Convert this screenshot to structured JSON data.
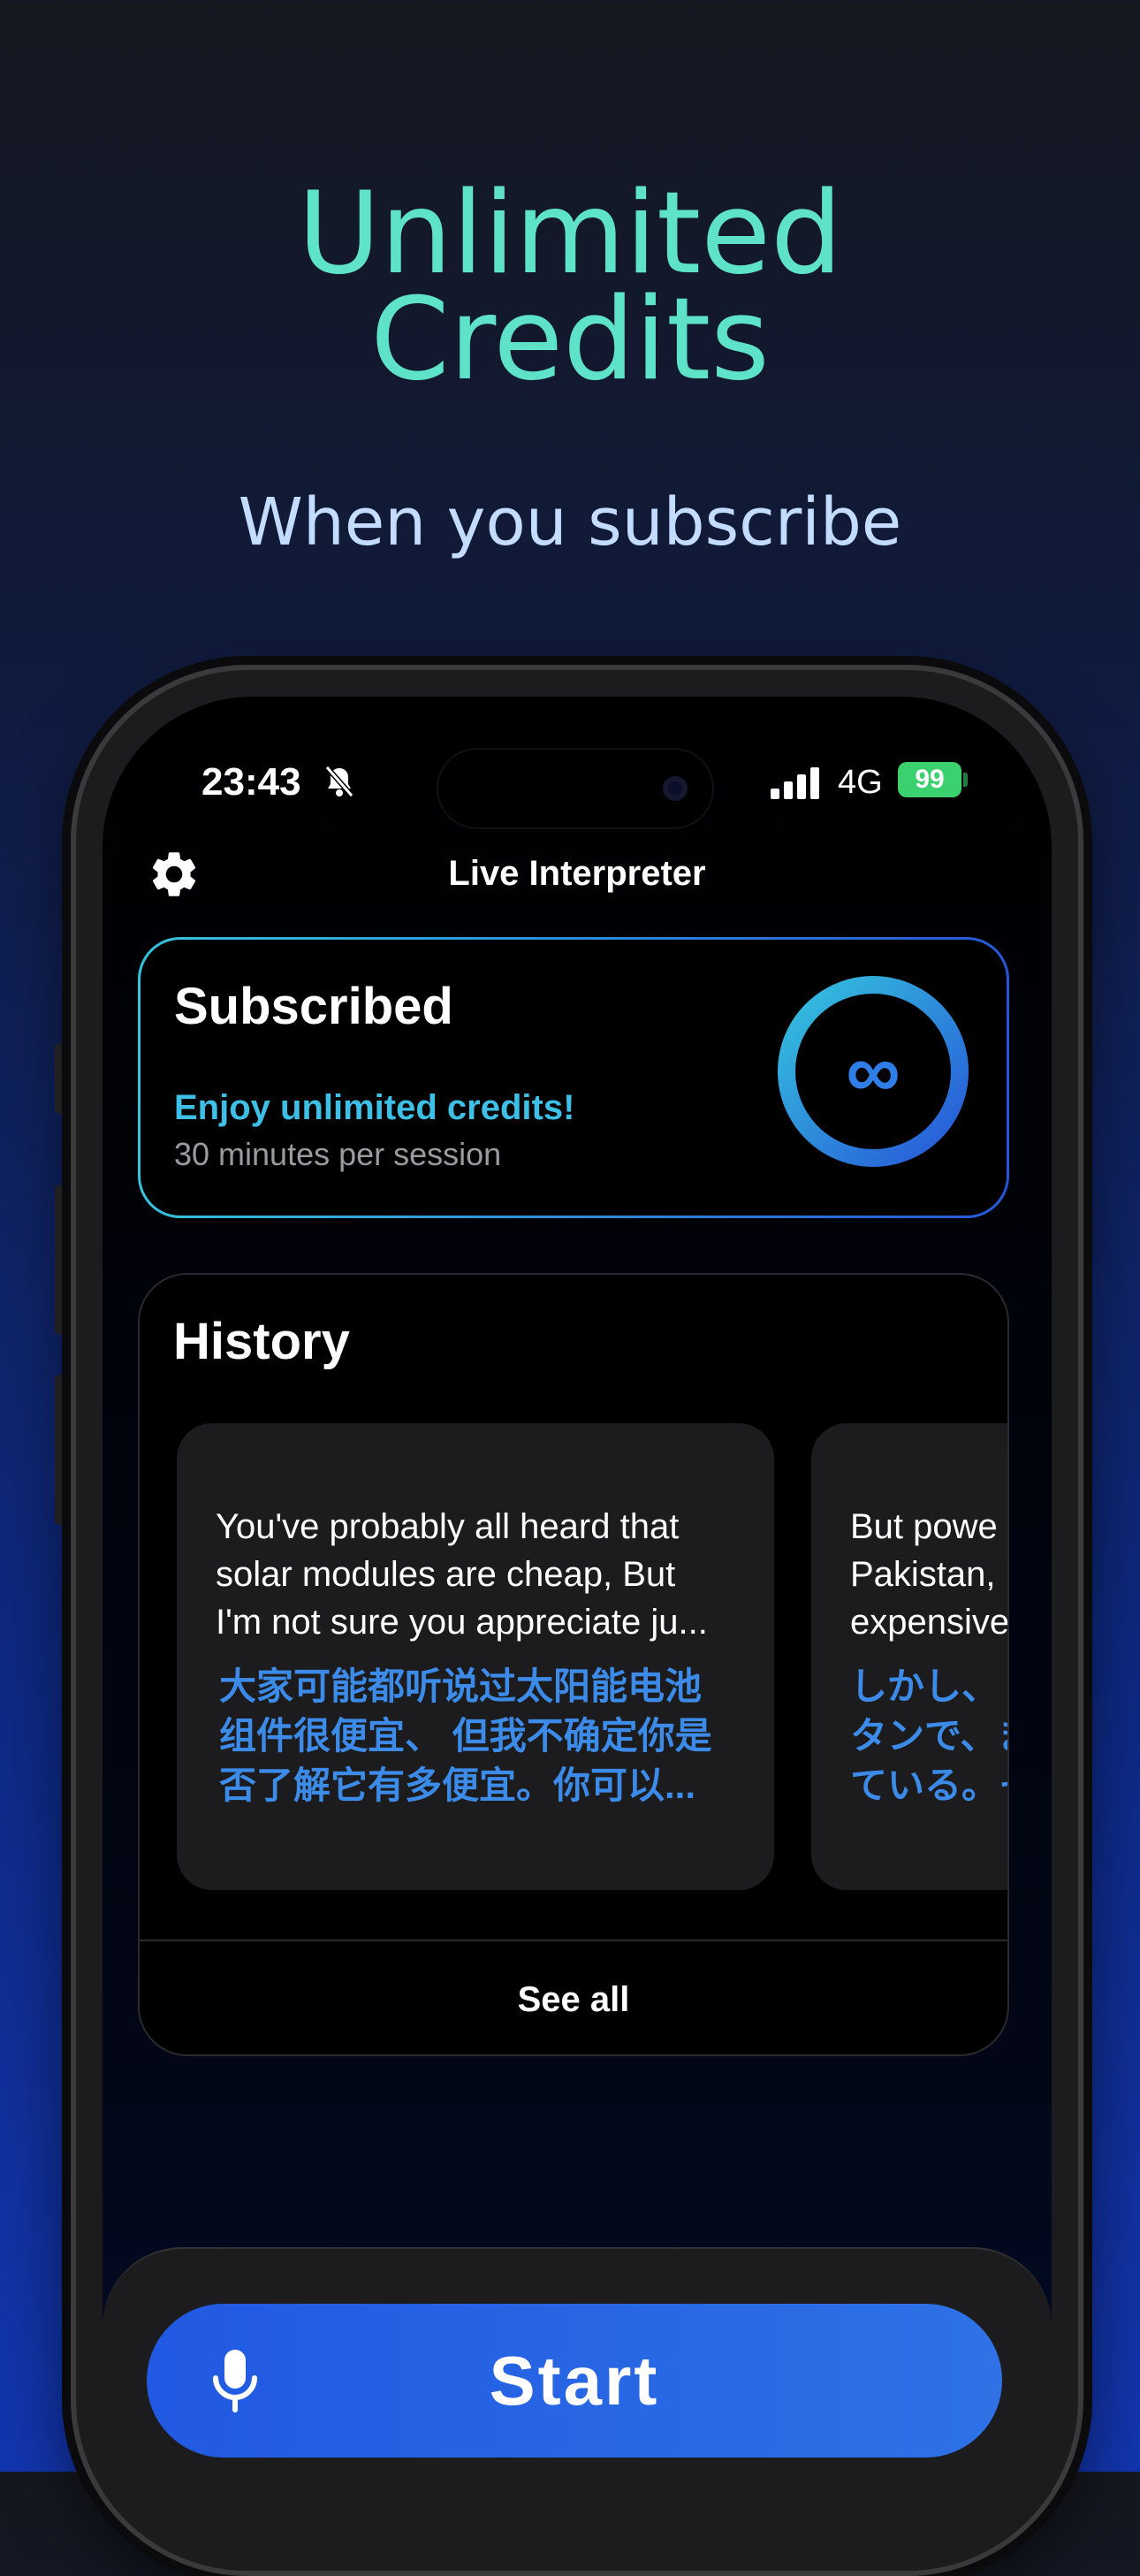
{
  "promo": {
    "title_line1": "Unlimited",
    "title_line2": "Credits",
    "subtitle": "When you subscribe"
  },
  "status_bar": {
    "time": "23:43",
    "network": "4G",
    "battery": "99"
  },
  "app": {
    "title": "Live Interpreter"
  },
  "subscription": {
    "title": "Subscribed",
    "tagline": "Enjoy unlimited credits!",
    "session_info": "30 minutes per session",
    "credit_symbol": "∞"
  },
  "history": {
    "title": "History",
    "items": [
      {
        "original": "You've probably all heard that\nsolar modules are cheap, But\nI'm not sure you appreciate ju...",
        "translation": "大家可能都听说过太阳能电池\n组件很便宜、 但我不确定你是\n否了解它有多便宜。你可以..."
      },
      {
        "original": "But powe\nPakistan,\nexpensive",
        "translation": "しかし、\nタンで、ま\nている。そ"
      }
    ],
    "see_all_label": "See all"
  },
  "action": {
    "start_label": "Start"
  },
  "colors": {
    "accent_teal": "#5fe3c8",
    "accent_blue": "#2f7ee8",
    "battery_green": "#3bd16f"
  },
  "icons": [
    "bell-slash-icon",
    "signal-icon",
    "gear-icon",
    "microphone-icon",
    "infinity-icon"
  ]
}
